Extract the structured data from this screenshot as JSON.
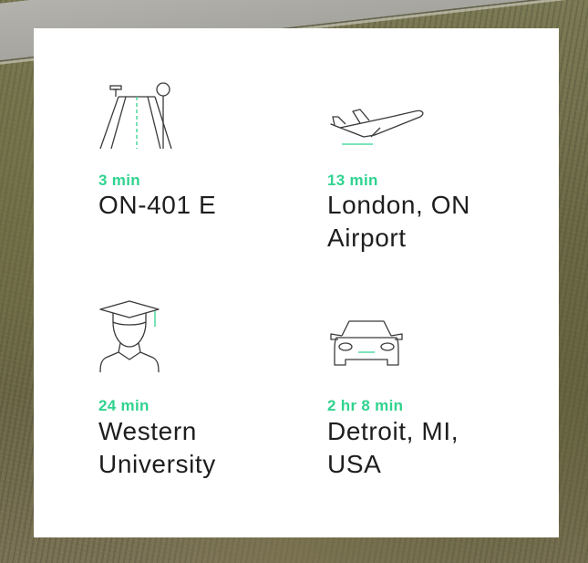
{
  "colors": {
    "accent": "#2fd38f",
    "text": "#1e1e1e",
    "icon_stroke": "#3a3a3a",
    "card_background": "#ffffff"
  },
  "destinations": [
    {
      "icon": "highway-road-icon",
      "time": "3 min",
      "place_lines": [
        "ON-401 E"
      ]
    },
    {
      "icon": "airplane-takeoff-icon",
      "time": "13 min",
      "place_lines": [
        "London, ON",
        "Airport"
      ]
    },
    {
      "icon": "graduate-student-icon",
      "time": "24 min",
      "place_lines": [
        "Western",
        "University"
      ]
    },
    {
      "icon": "car-front-icon",
      "time": "2 hr 8 min",
      "place_lines": [
        "Detroit, MI,",
        "USA"
      ]
    }
  ]
}
